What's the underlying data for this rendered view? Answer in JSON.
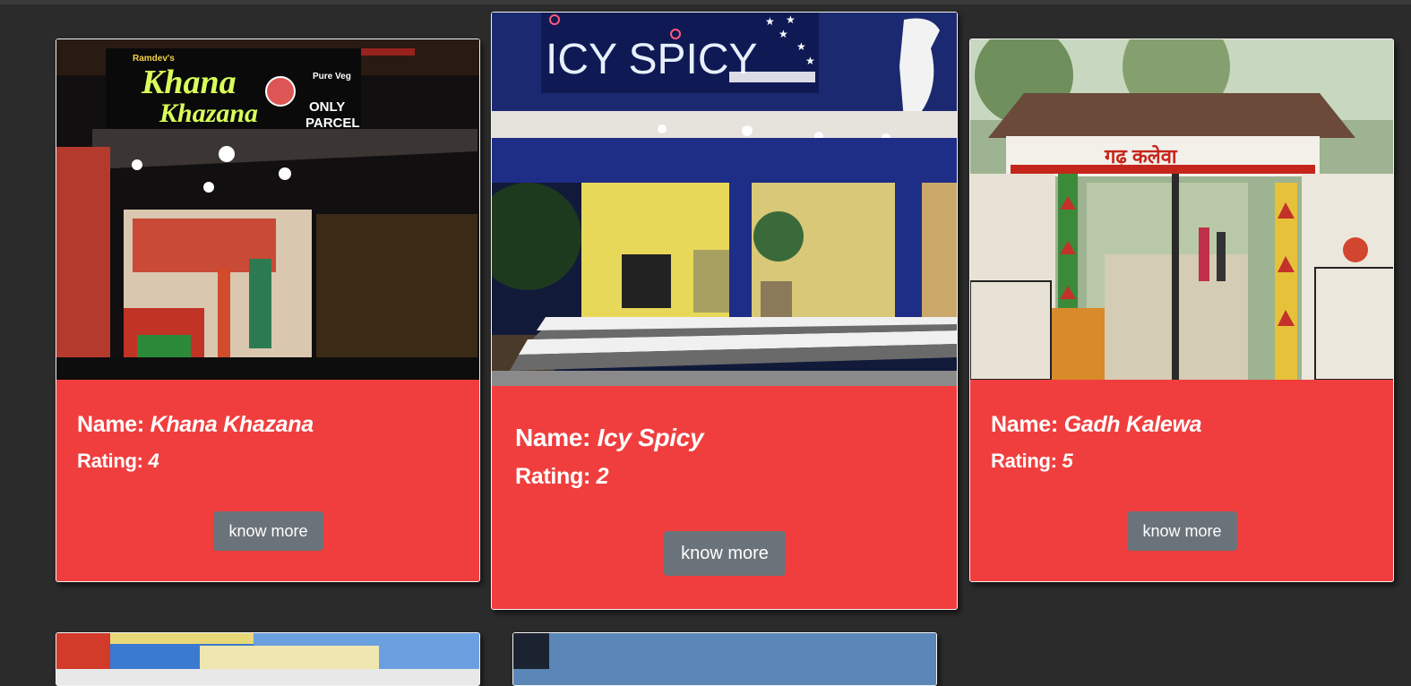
{
  "restaurants": [
    {
      "name_label": "Name:",
      "name": "Khana Khazana",
      "rating_label": "Rating:",
      "rating": "4",
      "button": "know more",
      "photo": {
        "brand_top": "Ramdev's",
        "sign_title_1": "Khana",
        "sign_title_2": "Khazana",
        "sign_badge": "Pure Veg",
        "sign_side_1": "ONLY",
        "sign_side_2": "PARCEL"
      }
    },
    {
      "name_label": "Name:",
      "name": "Icy Spicy",
      "rating_label": "Rating:",
      "rating": "2",
      "button": "know more",
      "photo": {
        "sign_title": "ICY SPICY"
      }
    },
    {
      "name_label": "Name:",
      "name": "Gadh Kalewa",
      "rating_label": "Rating:",
      "rating": "5",
      "button": "know more",
      "photo": {
        "sign_title": "गढ़ कलेवा"
      }
    }
  ],
  "colors": {
    "page_bg": "#2b2b2b",
    "card_bg": "#f03e3e",
    "button_bg": "#6b737a"
  }
}
